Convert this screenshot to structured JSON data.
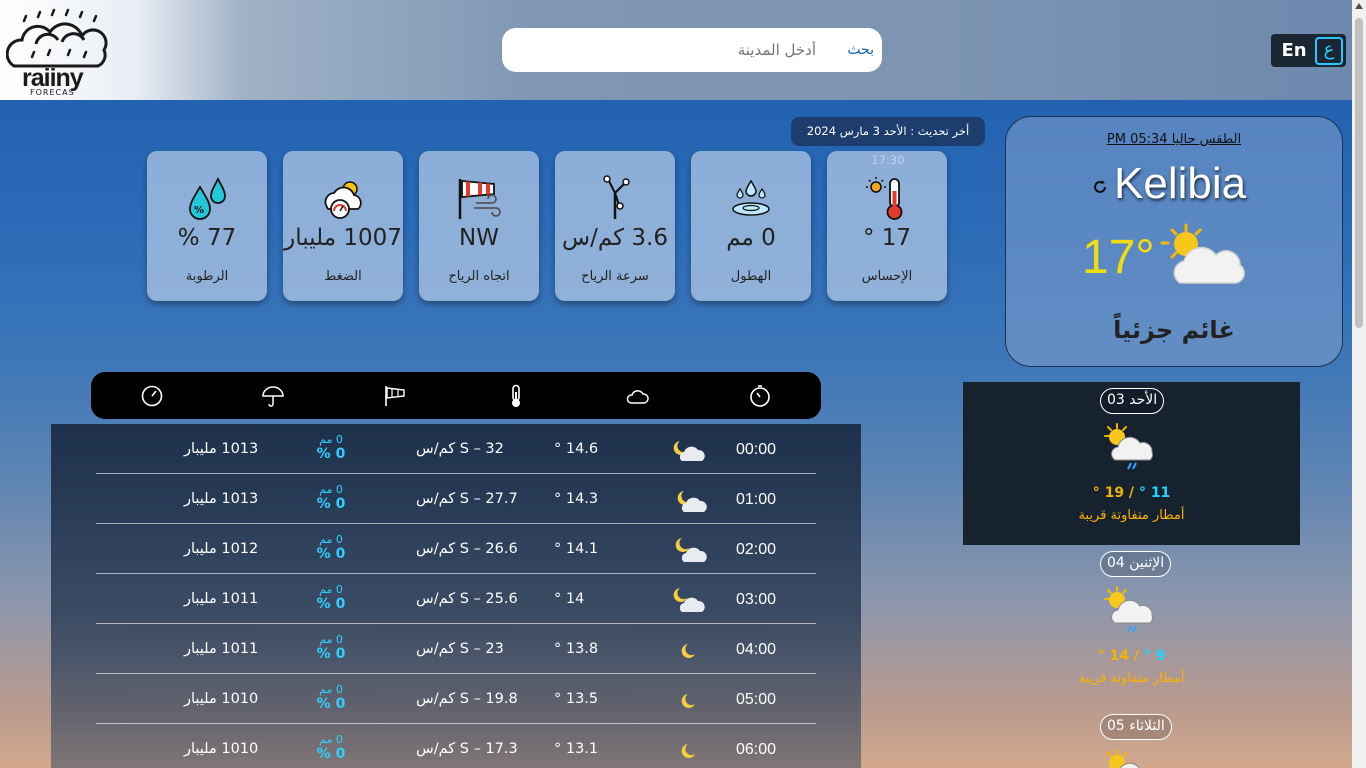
{
  "header": {
    "logo_text": "raiiny",
    "logo_sub": "FORECAS",
    "search_placeholder": "أدخل المدينة",
    "search_button": "بحث",
    "lang_en": "En",
    "lang_ar": "ع"
  },
  "update_text": "أخر تحديث : الأحد 3 مارس 2024 17:30",
  "stats": [
    {
      "id": "humidity",
      "value": "77 %",
      "label": "الرطوبة",
      "icon": "humidity-drops-icon"
    },
    {
      "id": "pressure",
      "value": "1007 مليبار",
      "label": "الضغط",
      "icon": "pressure-gauge-icon"
    },
    {
      "id": "wind_dir",
      "value": "NW",
      "label": "اتجاه الرياح",
      "icon": "windsock-icon"
    },
    {
      "id": "wind_speed",
      "value": "3.6 كم/س",
      "label": "سرعة الرياح",
      "icon": "anemometer-icon"
    },
    {
      "id": "precip",
      "value": "0 مم",
      "label": "الهطول",
      "icon": "rain-puddle-icon"
    },
    {
      "id": "feels",
      "value": "17 °",
      "label": "الإحساس",
      "icon": "thermometer-sun-icon"
    }
  ],
  "current": {
    "subtitle": "الطقس حاليا 05:34 PM",
    "city": "Kelibia",
    "temp": "17°",
    "description": "غائم جزئياً",
    "icon": "partly-cloudy-sun-icon"
  },
  "hourly_header_icons": [
    "pressure-gauge-icon",
    "umbrella-icon",
    "windsock-icon",
    "thermometer-icon",
    "cloud-icon",
    "stopwatch-icon"
  ],
  "hourly": [
    {
      "time": "00:00",
      "temp": "14.6 °",
      "wind": "S – 32 كم/س",
      "mm": "0 مم",
      "pct": "0 %",
      "pressure": "1013 مليبار",
      "icon": "cloudy-night-icon"
    },
    {
      "time": "01:00",
      "temp": "14.3 °",
      "wind": "S – 27.7 كم/س",
      "mm": "0 مم",
      "pct": "0 %",
      "pressure": "1013 مليبار",
      "icon": "cloudy-night-icon"
    },
    {
      "time": "02:00",
      "temp": "14.1 °",
      "wind": "S – 26.6 كم/س",
      "mm": "0 مم",
      "pct": "0 %",
      "pressure": "1012 مليبار",
      "icon": "cloudy-night-icon"
    },
    {
      "time": "03:00",
      "temp": "14 °",
      "wind": "S – 25.6 كم/س",
      "mm": "0 مم",
      "pct": "0 %",
      "pressure": "1011 مليبار",
      "icon": "cloudy-night-icon"
    },
    {
      "time": "04:00",
      "temp": "13.8 °",
      "wind": "S – 23 كم/س",
      "mm": "0 مم",
      "pct": "0 %",
      "pressure": "1011 مليبار",
      "icon": "moon-icon"
    },
    {
      "time": "05:00",
      "temp": "13.5 °",
      "wind": "S – 19.8 كم/س",
      "mm": "0 مم",
      "pct": "0 %",
      "pressure": "1010 مليبار",
      "icon": "moon-icon"
    },
    {
      "time": "06:00",
      "temp": "13.1 °",
      "wind": "S – 17.3 كم/س",
      "mm": "0 مم",
      "pct": "0 %",
      "pressure": "1010 مليبار",
      "icon": "moon-icon"
    }
  ],
  "daily": [
    {
      "day": "الأحد 03",
      "min": "11 °",
      "max": "19 °",
      "desc": "أمطار متفاوتة قريبة",
      "icon": "sun-cloud-rain-icon"
    },
    {
      "day": "الإثنين 04",
      "min": "9 °",
      "max": "14 °",
      "desc": "أمطار متفاوتة قريبة",
      "icon": "sun-cloud-rain-icon"
    },
    {
      "day": "الثلاثاء 05",
      "min": "",
      "max": "",
      "desc": "",
      "icon": "sun-cloud-icon"
    }
  ],
  "colors": {
    "accent": "#29c6ff",
    "temp_yellow": "#f2dd10",
    "desc_orange": "#ffb300"
  }
}
